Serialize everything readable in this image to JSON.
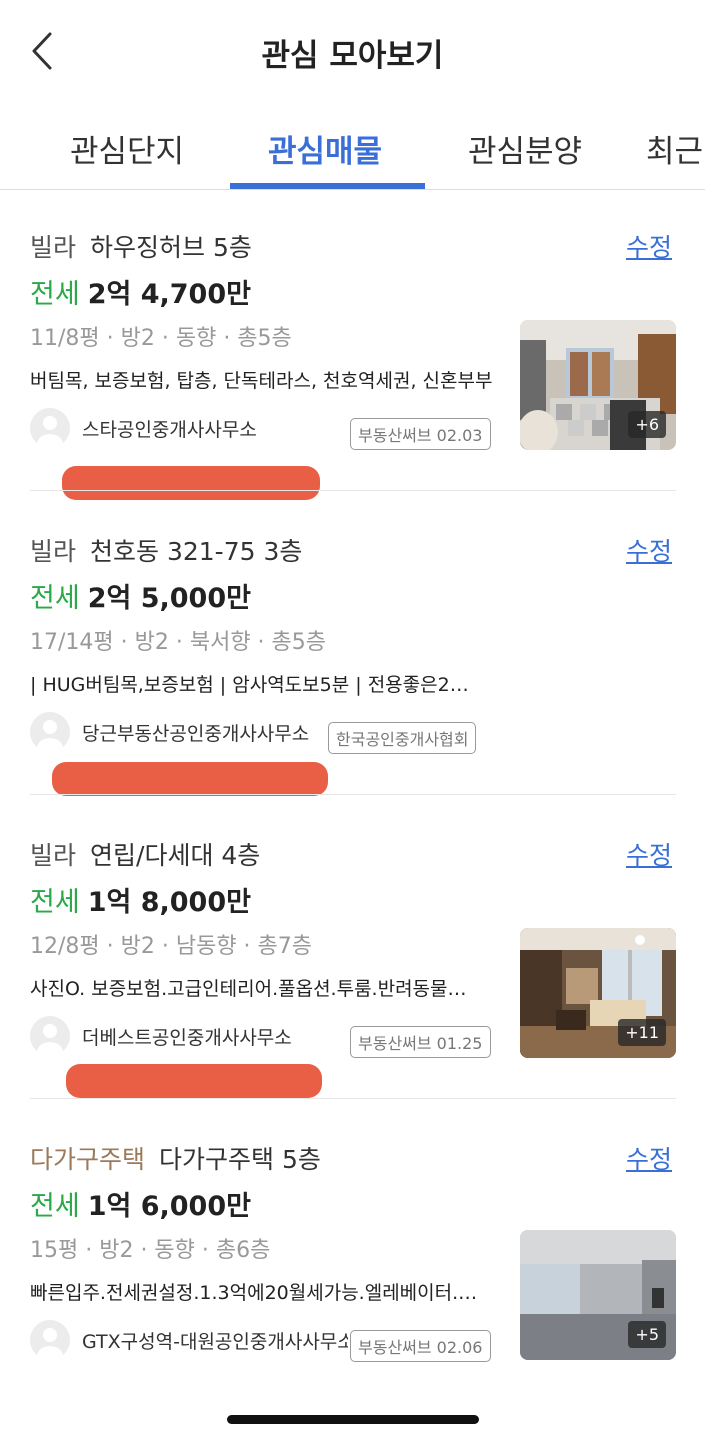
{
  "header": {
    "title": "관심 모아보기"
  },
  "tabs": [
    {
      "label": "관심단지",
      "active": false
    },
    {
      "label": "관심매물",
      "active": true
    },
    {
      "label": "관심분양",
      "active": false
    },
    {
      "label": "최근",
      "active": false
    }
  ],
  "colors": {
    "accent": "#3b6fd8",
    "deal": "#2aa84a",
    "redaction": "#e8563b",
    "type_brown": "#9a7a5a"
  },
  "listings": [
    {
      "type": "빌라",
      "name": "하우징허브 5층",
      "edit_label": "수정",
      "deal": "전세",
      "price": "2억 4,700만",
      "spec": "11/8평 · 방2 · 동향 · 총5층",
      "description": "버팀목, 보증보험, 탑층, 단독테라스, 천호역세권, 신혼부부",
      "agent": "스타공인중개사사무소",
      "badge": "부동산써브 02.03",
      "photo_count": "+6"
    },
    {
      "type": "빌라",
      "name": "천호동 321-75 3층",
      "edit_label": "수정",
      "deal": "전세",
      "price": "2억 5,000만",
      "spec": "17/14평 · 방2 · 북서향 · 총5층",
      "description": "| HUG버팀목,보증보험 | 암사역도보5분 | 전용좋은2…",
      "agent": "당근부동산공인중개사사무소",
      "badge": "한국공인중개사협회",
      "photo_count": ""
    },
    {
      "type": "빌라",
      "name": "연립/다세대 4층",
      "edit_label": "수정",
      "deal": "전세",
      "price": "1억 8,000만",
      "spec": "12/8평 · 방2 · 남동향 · 총7층",
      "description": "사진O. 보증보험.고급인테리어.풀옵션.투룸.반려동물…",
      "agent": "더베스트공인중개사사무소",
      "badge": "부동산써브 01.25",
      "photo_count": "+11"
    },
    {
      "type": "다가구주택",
      "name": "다가구주택 5층",
      "edit_label": "수정",
      "deal": "전세",
      "price": "1억 6,000만",
      "spec": "15평 · 방2 · 동향 · 총6층",
      "description": "빠른입주.전세권설정.1.3억에20월세가능.엘레베이터.…",
      "agent": "GTX구성역-대원공인중개사사무소",
      "badge": "부동산써브 02.06",
      "photo_count": "+5"
    }
  ]
}
